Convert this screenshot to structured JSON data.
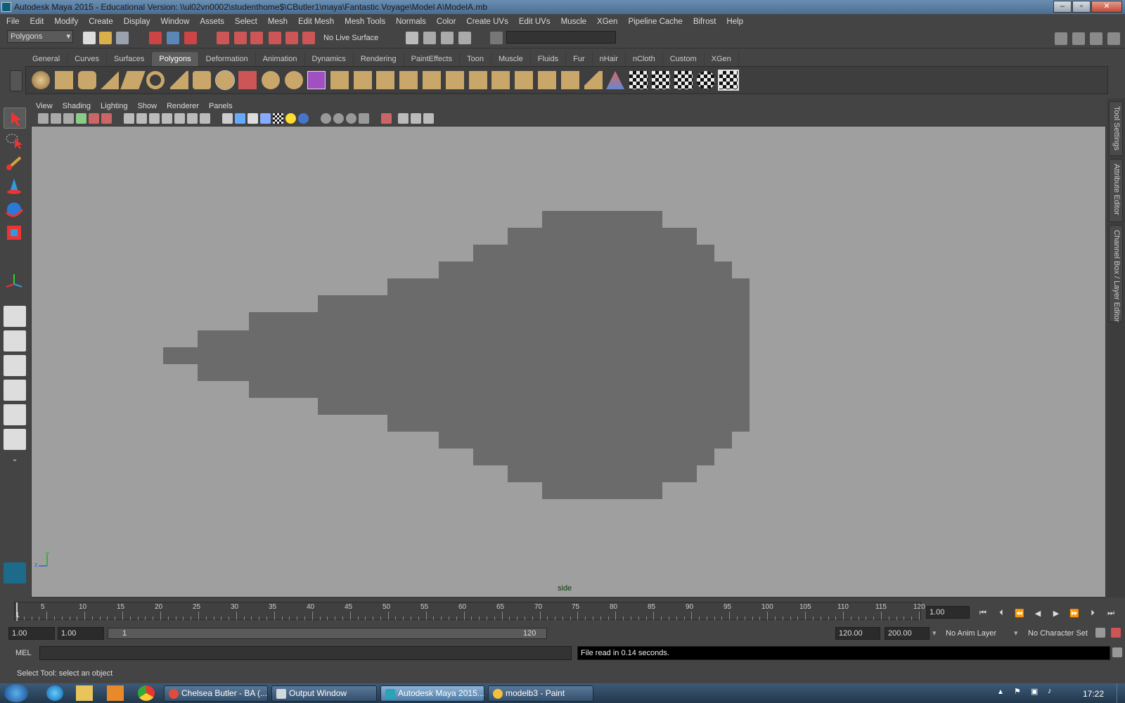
{
  "window": {
    "title": "Autodesk Maya 2015 - Educational Version: \\\\ul02vn0002\\studenthome$\\CButler1\\maya\\Fantastic Voyage\\Model A\\ModelA.mb",
    "minimize": "–",
    "maximize": "▫",
    "close": "✕"
  },
  "menus": [
    "File",
    "Edit",
    "Modify",
    "Create",
    "Display",
    "Window",
    "Assets",
    "Select",
    "Mesh",
    "Edit Mesh",
    "Mesh Tools",
    "Normals",
    "Color",
    "Create UVs",
    "Edit UVs",
    "Muscle",
    "XGen",
    "Pipeline Cache",
    "Bifrost",
    "Help"
  ],
  "status_line": {
    "menuset": "Polygons",
    "live_surface": "No Live Surface"
  },
  "shelf_tabs": [
    "General",
    "Curves",
    "Surfaces",
    "Polygons",
    "Deformation",
    "Animation",
    "Dynamics",
    "Rendering",
    "PaintEffects",
    "Toon",
    "Muscle",
    "Fluids",
    "Fur",
    "nHair",
    "nCloth",
    "Custom",
    "XGen"
  ],
  "active_shelf": "Polygons",
  "panel_menu": [
    "View",
    "Shading",
    "Lighting",
    "Show",
    "Renderer",
    "Panels"
  ],
  "viewport": {
    "camera": "side",
    "axis_z": "z",
    "axis_y": "y"
  },
  "right_tabs": [
    "Tool Settings",
    "Attribute Editor",
    "Channel Box / Layer Editor"
  ],
  "time_slider": {
    "ticks": [
      "5",
      "10",
      "15",
      "20",
      "25",
      "30",
      "35",
      "40",
      "45",
      "50",
      "55",
      "60",
      "65",
      "70",
      "75",
      "80",
      "85",
      "90",
      "95",
      "100",
      "105",
      "110",
      "115",
      "120"
    ],
    "current_frame_marker": "1",
    "current_time": "1.00"
  },
  "range_slider": {
    "start_time": "1.00",
    "playback_start": "1.00",
    "range_start": "1",
    "range_end": "120",
    "playback_end": "120.00",
    "end_time": "200.00",
    "anim_layer": "No Anim Layer",
    "character_set": "No Character Set"
  },
  "command_line": {
    "mode": "MEL",
    "input": "",
    "result": "File read in  0.14 seconds."
  },
  "help_line": "Select Tool: select an object",
  "taskbar": {
    "items": [
      {
        "label": "Chelsea Butler - BA (...",
        "icon": "chrome-icon",
        "color": "#e04c3c"
      },
      {
        "label": "Output Window",
        "icon": "window-icon",
        "color": "#d0d8e0"
      },
      {
        "label": "Autodesk Maya 2015...",
        "icon": "maya-icon",
        "color": "#2aa3b8"
      },
      {
        "label": "modelb3 - Paint",
        "icon": "paint-icon",
        "color": "#f0c040"
      }
    ],
    "time": "17:22"
  },
  "colors": {
    "viewport_bg": "#9f9f9f",
    "object": "#6b6b6b",
    "ui_bg": "#444444"
  }
}
